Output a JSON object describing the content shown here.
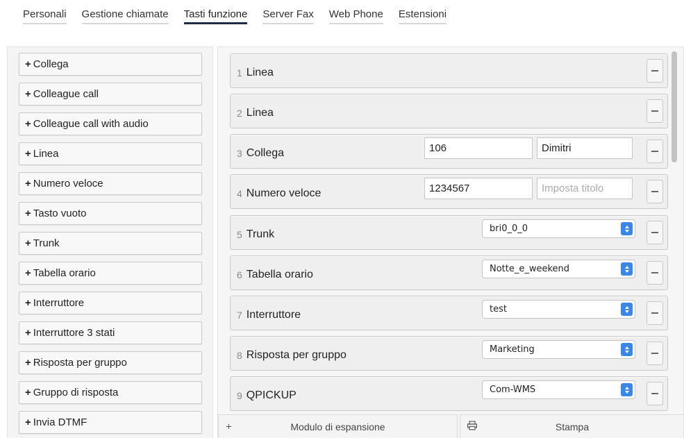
{
  "tabs": [
    {
      "label": "Personali",
      "active": false
    },
    {
      "label": "Gestione chiamate",
      "active": false
    },
    {
      "label": "Tasti funzione",
      "active": true
    },
    {
      "label": "Server Fax",
      "active": false
    },
    {
      "label": "Web Phone",
      "active": false
    },
    {
      "label": "Estensioni",
      "active": false
    }
  ],
  "left_panel": {
    "add_prefix": "+",
    "items": [
      {
        "label": "Collega"
      },
      {
        "label": "Colleague call"
      },
      {
        "label": "Colleague call with audio"
      },
      {
        "label": "Linea"
      },
      {
        "label": "Numero veloce"
      },
      {
        "label": "Tasto vuoto"
      },
      {
        "label": "Trunk"
      },
      {
        "label": "Tabella orario"
      },
      {
        "label": "Interruttore"
      },
      {
        "label": "Interruttore 3 stati"
      },
      {
        "label": "Risposta per gruppo"
      },
      {
        "label": "Gruppo di risposta"
      },
      {
        "label": "Invia DTMF"
      }
    ]
  },
  "keys": [
    {
      "num": "1",
      "name": "Linea"
    },
    {
      "num": "2",
      "name": "Linea"
    },
    {
      "num": "3",
      "name": "Collega",
      "value": "106",
      "title": "Dimitri",
      "title_placeholder": "Imposta titolo"
    },
    {
      "num": "4",
      "name": "Numero veloce",
      "value": "1234567",
      "title": "",
      "title_placeholder": "Imposta titolo"
    },
    {
      "num": "5",
      "name": "Trunk",
      "select": "bri0_0_0"
    },
    {
      "num": "6",
      "name": "Tabella orario",
      "select": "Notte_e_weekend"
    },
    {
      "num": "7",
      "name": "Interruttore",
      "select": "test"
    },
    {
      "num": "8",
      "name": "Risposta per gruppo",
      "select": "Marketing"
    },
    {
      "num": "9",
      "name": "QPICKUP",
      "select": "Com-WMS"
    }
  ],
  "bottom": {
    "expansion_label": "Modulo di espansione",
    "expansion_icon": "plus-icon",
    "print_label": "Stampa",
    "print_icon": "printer-icon"
  },
  "colors": {
    "active_tab_underline": "#1f2a44",
    "select_stepper": "#3d87e4"
  }
}
